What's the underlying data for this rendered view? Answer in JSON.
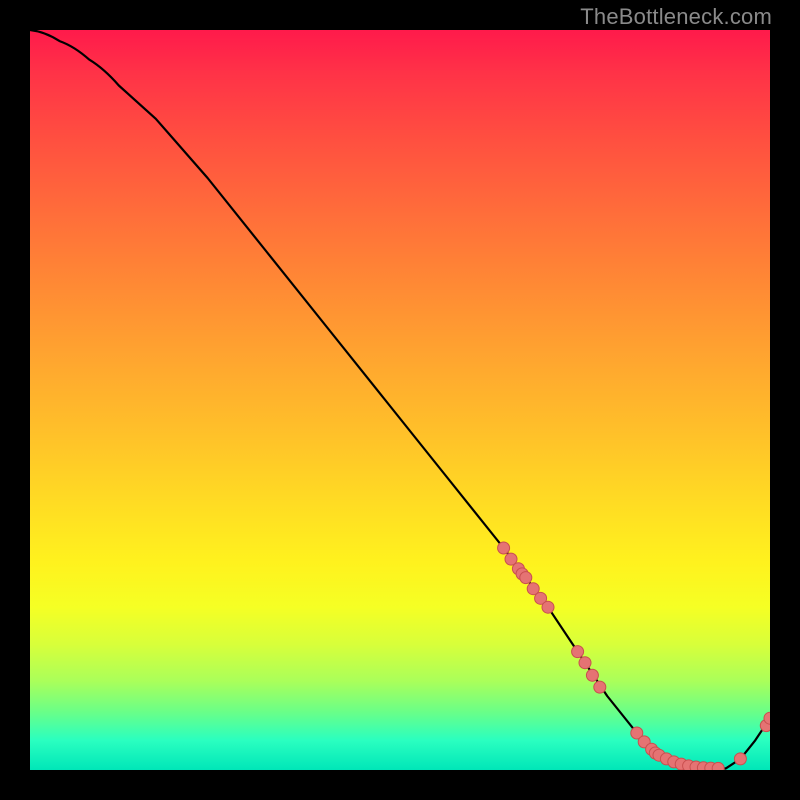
{
  "watermark": "TheBottleneck.com",
  "colors": {
    "line": "#000000",
    "marker_fill": "#e57373",
    "marker_stroke": "#c94f4f",
    "background_top": "#ff1a4b",
    "background_bottom": "#00e6b8"
  },
  "chart_data": {
    "type": "line",
    "title": "",
    "xlabel": "",
    "ylabel": "",
    "xlim": [
      0,
      100
    ],
    "ylim": [
      0,
      100
    ],
    "grid": false,
    "series": [
      {
        "name": "bottleneck-curve",
        "x": [
          0,
          4,
          8,
          12,
          17,
          24,
          32,
          40,
          48,
          56,
          64,
          70,
          74,
          78,
          82,
          85,
          88,
          91,
          94,
          96,
          98,
          100
        ],
        "y": [
          100,
          98.5,
          96,
          92.5,
          88,
          80,
          70,
          60,
          50,
          40,
          30,
          22,
          16,
          10,
          5,
          2,
          0.8,
          0.3,
          0.2,
          1.5,
          4,
          7
        ]
      }
    ],
    "markers": [
      {
        "name": "cluster-upper",
        "points": [
          {
            "x": 64,
            "y": 30
          },
          {
            "x": 65,
            "y": 28.5
          },
          {
            "x": 66,
            "y": 27.2
          },
          {
            "x": 66.5,
            "y": 26.5
          },
          {
            "x": 67,
            "y": 26
          },
          {
            "x": 68,
            "y": 24.5
          },
          {
            "x": 69,
            "y": 23.2
          },
          {
            "x": 70,
            "y": 22
          }
        ]
      },
      {
        "name": "cluster-elbow",
        "points": [
          {
            "x": 74,
            "y": 16
          },
          {
            "x": 75,
            "y": 14.5
          },
          {
            "x": 76,
            "y": 12.8
          },
          {
            "x": 77,
            "y": 11.2
          }
        ]
      },
      {
        "name": "cluster-valley",
        "points": [
          {
            "x": 82,
            "y": 5
          },
          {
            "x": 83,
            "y": 3.8
          },
          {
            "x": 84,
            "y": 2.8
          },
          {
            "x": 84.5,
            "y": 2.3
          },
          {
            "x": 85,
            "y": 2
          },
          {
            "x": 86,
            "y": 1.5
          },
          {
            "x": 87,
            "y": 1.1
          },
          {
            "x": 88,
            "y": 0.8
          },
          {
            "x": 89,
            "y": 0.55
          },
          {
            "x": 90,
            "y": 0.4
          },
          {
            "x": 91,
            "y": 0.3
          },
          {
            "x": 92,
            "y": 0.25
          },
          {
            "x": 93,
            "y": 0.22
          }
        ]
      },
      {
        "name": "cluster-rise",
        "points": [
          {
            "x": 96,
            "y": 1.5
          },
          {
            "x": 99.5,
            "y": 6
          },
          {
            "x": 100,
            "y": 7
          }
        ]
      }
    ]
  }
}
